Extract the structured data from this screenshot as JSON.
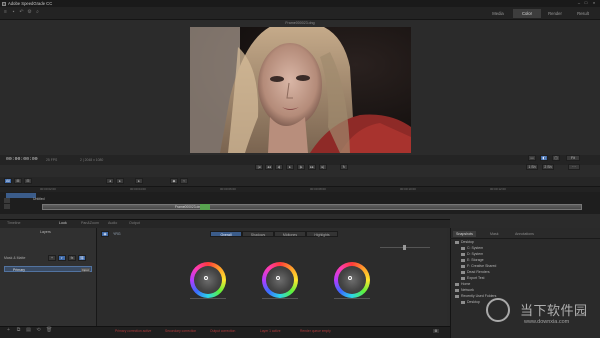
{
  "window": {
    "title": "Adobe SpeedGrade CC"
  },
  "workspace_tabs": [
    {
      "label": "Media",
      "active": false
    },
    {
      "label": "Color",
      "active": true
    },
    {
      "label": "Render",
      "active": false
    },
    {
      "label": "Result",
      "active": false
    }
  ],
  "viewer": {
    "frame_label": "Frame000023.dng"
  },
  "transport": {
    "timecode": "00:00:00:00",
    "fps": "25 FPS",
    "info": "2 | 2048 x 1080",
    "range_left": "1 Sh",
    "range_right": "2 Sh",
    "zoom": "Fit"
  },
  "timeline": {
    "track_label": "Untitled",
    "clip_label": "Frame000023.dng",
    "ruler_ticks": [
      "00:00:02:00",
      "00:00:04:00",
      "00:00:06:00",
      "00:00:08:00",
      "00:00:10:00",
      "00:00:12:00"
    ]
  },
  "panel_tabs": [
    {
      "label": "Timeline",
      "active": false
    },
    {
      "label": "Look",
      "active": true
    },
    {
      "label": "Pan&Zoom",
      "active": false
    },
    {
      "label": "Audio",
      "active": false
    },
    {
      "label": "Output",
      "active": false
    }
  ],
  "left_panel": {
    "layers_label": "Layers",
    "mask_label": "Mask & Matte",
    "layer_name": "Primary",
    "layer_badge": "Input"
  },
  "color": {
    "mode_label": "YRG",
    "segments": [
      {
        "label": "Overall",
        "selected": true
      },
      {
        "label": "Shadows",
        "selected": false
      },
      {
        "label": "Midtones",
        "selected": false
      },
      {
        "label": "Highlights",
        "selected": false
      }
    ],
    "wheels": [
      "Offset",
      "Gamma",
      "Gain"
    ]
  },
  "right_panel": {
    "tabs": [
      {
        "label": "Snapshots",
        "active": true
      },
      {
        "label": "Mask",
        "active": false
      },
      {
        "label": "Annotations",
        "active": false
      }
    ],
    "tree": [
      {
        "label": "Desktop",
        "depth": 0
      },
      {
        "label": "C: System",
        "depth": 1
      },
      {
        "label": "D: System",
        "depth": 1
      },
      {
        "label": "E: Storage",
        "depth": 1
      },
      {
        "label": "F: Creative Shared",
        "depth": 1
      },
      {
        "label": "Dead Renders",
        "depth": 1
      },
      {
        "label": "Export Test",
        "depth": 1
      },
      {
        "label": "Home",
        "depth": 0
      },
      {
        "label": "Network",
        "depth": 0
      },
      {
        "label": "Recently Used Folders",
        "depth": 0
      },
      {
        "label": "Desktop",
        "depth": 1
      }
    ]
  },
  "bottom_bar": {
    "status_items": [
      "Primary correction active",
      "Secondary correction",
      "Output correction",
      "Layer 1 active",
      "Render queue empty"
    ]
  },
  "watermark": {
    "brand": "当下软件园",
    "url": "www.downxia.com"
  },
  "colors": {
    "accent": "#3f6aa8",
    "background": "#2b2b2b",
    "error": "#b33b3b"
  }
}
